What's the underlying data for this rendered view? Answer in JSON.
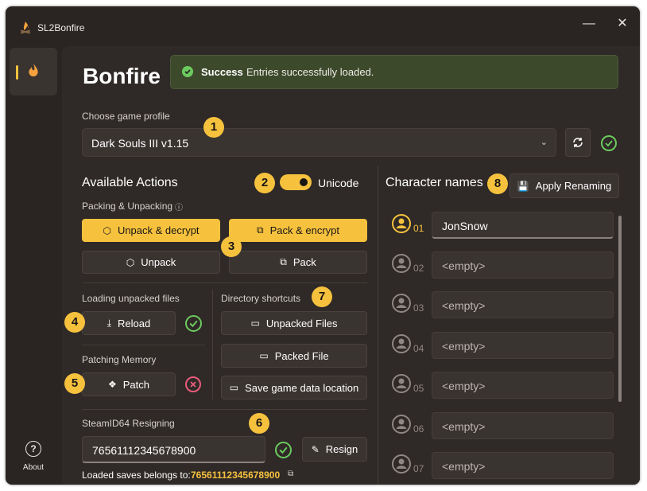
{
  "app": {
    "title": "SL2Bonfire",
    "page_title": "Bonfire"
  },
  "window_controls": {
    "minimize": "—",
    "close": "✕"
  },
  "nav": {
    "about_label": "About"
  },
  "toast": {
    "title": "Success",
    "message": "Entries successfully loaded."
  },
  "profile": {
    "label": "Choose game profile",
    "selected": "Dark Souls III v1.15"
  },
  "actions": {
    "title": "Available Actions",
    "unicode_label": "Unicode",
    "unicode_on": true,
    "packing_label": "Packing & Unpacking",
    "unpack_decrypt": "Unpack & decrypt",
    "pack_encrypt": "Pack & encrypt",
    "unpack": "Unpack",
    "pack": "Pack"
  },
  "loading": {
    "label": "Loading unpacked files",
    "reload": "Reload"
  },
  "patching": {
    "label": "Patching Memory",
    "patch": "Patch"
  },
  "shortcuts": {
    "label": "Directory shortcuts",
    "unpacked_files": "Unpacked Files",
    "packed_file": "Packed File",
    "save_location": "Save game data location"
  },
  "steam": {
    "label": "SteamID64 Resigning",
    "value": "76561112345678900",
    "resign": "Resign",
    "belongs_label": "Loaded saves belongs to:",
    "belongs_value": "76561112345678900"
  },
  "characters": {
    "title": "Character names",
    "apply": "Apply Renaming",
    "rows": [
      {
        "num": "01",
        "name": "JonSnow"
      },
      {
        "num": "02",
        "name": "<empty>"
      },
      {
        "num": "03",
        "name": "<empty>"
      },
      {
        "num": "04",
        "name": "<empty>"
      },
      {
        "num": "05",
        "name": "<empty>"
      },
      {
        "num": "06",
        "name": "<empty>"
      },
      {
        "num": "07",
        "name": "<empty>"
      }
    ]
  },
  "callouts": [
    "1",
    "2",
    "3",
    "4",
    "5",
    "6",
    "7",
    "8"
  ],
  "colors": {
    "accent": "#f6c23e",
    "success": "#6ccb5f",
    "error": "#e85c7a",
    "background": "#2f2927"
  }
}
